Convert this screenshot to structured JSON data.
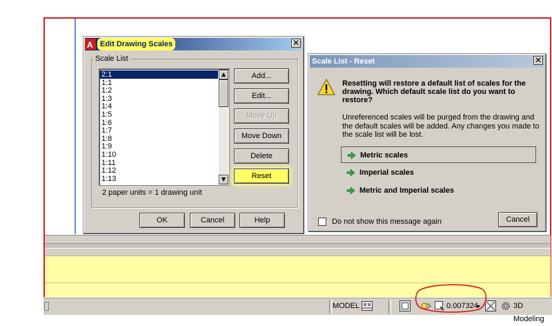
{
  "edit_dialog": {
    "title": "Edit Drawing Scales",
    "group_label": "Scale List",
    "scales": [
      "2:1",
      "1:1",
      "1:2",
      "1:3",
      "1:4",
      "1:5",
      "1:6",
      "1:7",
      "1:8",
      "1:9",
      "1:10",
      "1:11",
      "1:12",
      "1:13"
    ],
    "selected_scale": "2:1",
    "units_text": "2 paper units = 1 drawing unit",
    "buttons": {
      "add": "Add...",
      "edit": "Edit...",
      "move_up": "Move Up",
      "move_down": "Move Down",
      "delete": "Delete",
      "reset": "Reset"
    },
    "footer": {
      "ok": "OK",
      "cancel": "Cancel",
      "help": "Help"
    },
    "close_glyph": "✕"
  },
  "reset_dialog": {
    "title": "Scale List - Reset",
    "heading": "Resetting will restore a default list of scales for the drawing. Which default scale list do you want to restore?",
    "description": "Unreferenced scales will be purged from the drawing and the default scales will be added. Any changes you made to the scale list will be lost.",
    "options": [
      "Metric scales",
      "Imperial scales",
      "Metric and Imperial scales"
    ],
    "checkbox_label": "Do not show this message again",
    "cancel": "Cancel",
    "close_glyph": "✕"
  },
  "statusbar": {
    "model_label": "MODEL",
    "annotation_scale": "0.007324",
    "workspace": "3D Modeling"
  },
  "colors": {
    "title_gradient_start": "#0a246a",
    "title_gradient_end": "#a6caf0",
    "highlight": "#ffff60",
    "annotation_red": "#e01010",
    "option_arrow": "#2fa43a"
  }
}
